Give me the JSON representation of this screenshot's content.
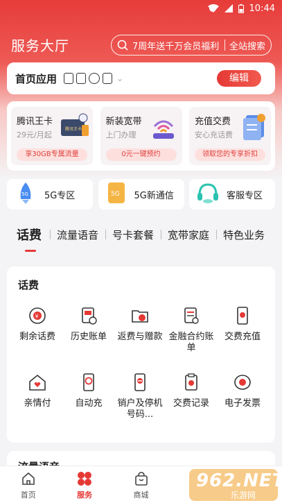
{
  "status_bar": {
    "time": "10:44"
  },
  "header": {
    "title": "服务大厅",
    "search_placeholder": "7周年送千万会员福利",
    "search_button": "全站搜索"
  },
  "home_apps": {
    "label": "首页应用",
    "edit_label": "编辑"
  },
  "promos": [
    {
      "title": "腾讯王卡",
      "subtitle": "29元/月起",
      "pill": "享30GB专属流量",
      "card_text": "腾讯王卡"
    },
    {
      "title": "新装宽带",
      "subtitle": "上门办理",
      "pill": "0元一键预约"
    },
    {
      "title": "充值交费",
      "subtitle": "安心充话费",
      "pill": "领取您的专享折扣"
    }
  ],
  "zones": [
    {
      "label": "5G专区",
      "badge": "5G"
    },
    {
      "label": "5G新通信",
      "badge": "5G"
    },
    {
      "label": "客服专区"
    }
  ],
  "tabs": [
    "话费",
    "流量语音",
    "号卡套餐",
    "宽带家庭",
    "特色业务"
  ],
  "fee_section": {
    "title": "话费",
    "items": [
      {
        "label": "剩余话费"
      },
      {
        "label": "历史账单"
      },
      {
        "label": "返费与赠款"
      },
      {
        "label": "金融合约账单"
      },
      {
        "label": "交费充值"
      },
      {
        "label": "亲情付"
      },
      {
        "label": "自动充"
      },
      {
        "label": "销户及停机号码..."
      },
      {
        "label": "交费记录"
      },
      {
        "label": "电子发票"
      }
    ]
  },
  "next_section": {
    "title": "流量语音"
  },
  "bottom_nav": [
    {
      "label": "首页"
    },
    {
      "label": "服务"
    },
    {
      "label": "商城"
    },
    {
      "label": ""
    },
    {
      "label": ""
    }
  ],
  "watermark": {
    "main": "962.NET",
    "sub": "乐游网"
  },
  "colors": {
    "brand_red": "#e53935",
    "page_bg": "#f4f4f6"
  }
}
